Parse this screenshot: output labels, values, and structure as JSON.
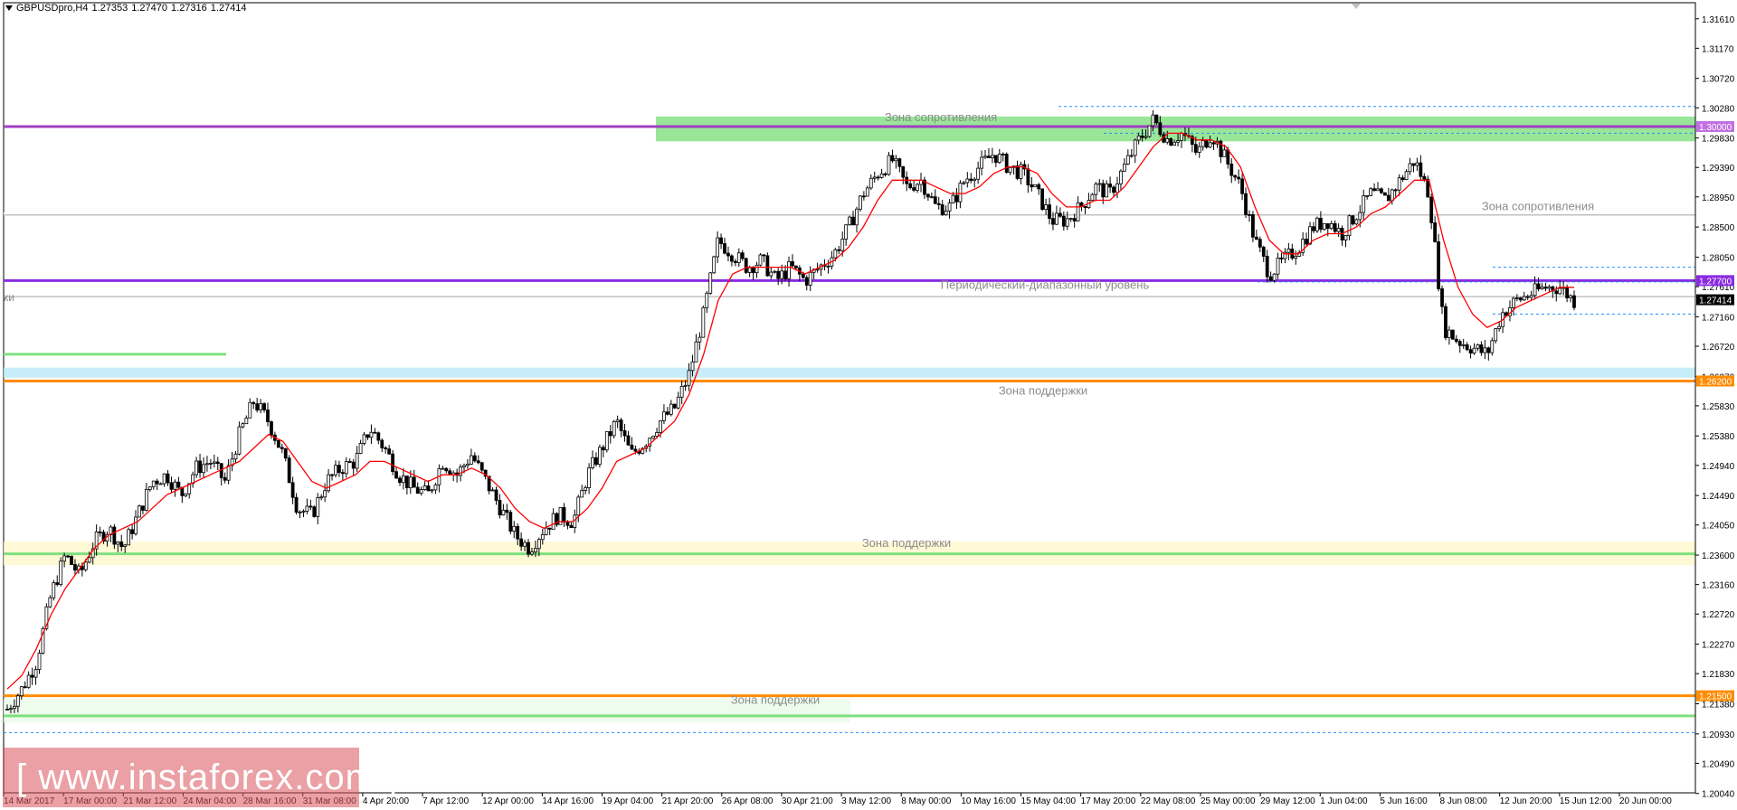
{
  "header": {
    "symbol": "GBPUSDpro,H4",
    "open": "1.27353",
    "high": "1.27470",
    "low": "1.27316",
    "close": "1.27414"
  },
  "watermark": "[ www.instaforex.com ]",
  "left_cut_label": "ки",
  "colors": {
    "candle": "#000000",
    "ma": "#ff0000",
    "zone_green": "#7fe07f",
    "level_purple": "#a040c0",
    "level_violet": "#8a2be2",
    "level_orange": "#ff8c00",
    "level_gray": "#c0c0c0",
    "dashed": "#1e90ff",
    "grid_axis": "#000000"
  },
  "chart_data": {
    "type": "line",
    "title": "GBPUSDpro,H4",
    "instrument": "GBPUSDpro",
    "timeframe": "H4",
    "ylim": [
      1.2005,
      1.3185
    ],
    "y_ticks": [
      "1.31610",
      "1.31170",
      "1.30720",
      "1.30280",
      "1.29830",
      "1.29390",
      "1.28950",
      "1.28500",
      "1.28050",
      "1.27610",
      "1.27160",
      "1.26720",
      "1.26270",
      "1.25830",
      "1.25380",
      "1.24940",
      "1.24490",
      "1.24050",
      "1.23600",
      "1.23160",
      "1.22720",
      "1.22270",
      "1.21830",
      "1.21380",
      "1.20930",
      "1.20490",
      "1.20040"
    ],
    "x_ticks": [
      "14 Mar 2017",
      "17 Mar 00:00",
      "21 Mar 12:00",
      "24 Mar 04:00",
      "28 Mar 16:00",
      "31 Mar 08:00",
      "4 Apr 20:00",
      "7 Apr 12:00",
      "12 Apr 00:00",
      "14 Apr 16:00",
      "19 Apr 04:00",
      "21 Apr 20:00",
      "26 Apr 08:00",
      "30 Apr 21:00",
      "3 May 12:00",
      "8 May 00:00",
      "10 May 16:00",
      "15 May 04:00",
      "17 May 20:00",
      "22 May 08:00",
      "25 May 00:00",
      "29 May 12:00",
      "1 Jun 04:00",
      "5 Jun 16:00",
      "8 Jun 08:00",
      "12 Jun 20:00",
      "15 Jun 12:00",
      "20 Jun 00:00"
    ],
    "price_close_path": [
      1.213,
      1.216,
      1.22,
      1.23,
      1.236,
      1.233,
      1.238,
      1.24,
      1.237,
      1.242,
      1.247,
      1.248,
      1.245,
      1.249,
      1.25,
      1.247,
      1.254,
      1.259,
      1.256,
      1.251,
      1.243,
      1.242,
      1.247,
      1.249,
      1.25,
      1.255,
      1.252,
      1.248,
      1.246,
      1.245,
      1.25,
      1.248,
      1.251,
      1.247,
      1.243,
      1.239,
      1.237,
      1.24,
      1.242,
      1.241,
      1.248,
      1.252,
      1.256,
      1.251,
      1.253,
      1.256,
      1.258,
      1.263,
      1.272,
      1.283,
      1.281,
      1.279,
      1.28,
      1.277,
      1.279,
      1.277,
      1.279,
      1.281,
      1.285,
      1.29,
      1.293,
      1.295,
      1.291,
      1.292,
      1.288,
      1.288,
      1.292,
      1.294,
      1.296,
      1.294,
      1.293,
      1.29,
      1.286,
      1.286,
      1.288,
      1.291,
      1.29,
      1.294,
      1.298,
      1.301,
      1.298,
      1.299,
      1.296,
      1.299,
      1.295,
      1.291,
      1.283,
      1.278,
      1.28,
      1.282,
      1.285,
      1.286,
      1.284,
      1.287,
      1.29,
      1.289,
      1.292,
      1.295,
      1.29,
      1.27,
      1.268,
      1.267,
      1.266,
      1.272,
      1.274,
      1.275,
      1.276,
      1.276,
      1.274
    ],
    "ma_path": [
      1.216,
      1.218,
      1.222,
      1.227,
      1.231,
      1.234,
      1.237,
      1.239,
      1.24,
      1.241,
      1.243,
      1.245,
      1.246,
      1.247,
      1.248,
      1.249,
      1.25,
      1.252,
      1.254,
      1.253,
      1.25,
      1.247,
      1.246,
      1.247,
      1.248,
      1.25,
      1.25,
      1.249,
      1.248,
      1.247,
      1.248,
      1.248,
      1.249,
      1.248,
      1.246,
      1.243,
      1.241,
      1.24,
      1.241,
      1.241,
      1.243,
      1.246,
      1.25,
      1.251,
      1.252,
      1.254,
      1.256,
      1.26,
      1.266,
      1.274,
      1.278,
      1.279,
      1.279,
      1.279,
      1.279,
      1.278,
      1.279,
      1.28,
      1.282,
      1.285,
      1.289,
      1.292,
      1.292,
      1.292,
      1.291,
      1.29,
      1.29,
      1.291,
      1.293,
      1.294,
      1.294,
      1.293,
      1.29,
      1.288,
      1.288,
      1.289,
      1.289,
      1.291,
      1.294,
      1.297,
      1.299,
      1.299,
      1.298,
      1.298,
      1.297,
      1.294,
      1.288,
      1.283,
      1.281,
      1.281,
      1.283,
      1.284,
      1.284,
      1.285,
      1.287,
      1.288,
      1.29,
      1.292,
      1.292,
      1.283,
      1.276,
      1.272,
      1.27,
      1.271,
      1.273,
      1.274,
      1.275,
      1.276,
      1.276
    ],
    "levels": [
      {
        "price": 1.3,
        "label": "1.30000",
        "color": "#a040c0"
      },
      {
        "price": 1.277,
        "label": "1.27700",
        "color": "#8a2be2"
      },
      {
        "price": 1.262,
        "label": "1.26200",
        "color": "#ff8c00"
      },
      {
        "price": 1.215,
        "label": "1.21500",
        "color": "#ff8c00"
      },
      {
        "price": 1.2868,
        "label": "",
        "color": "#c0c0c0"
      },
      {
        "price": 1.2746,
        "label": "",
        "color": "#c0c0c0"
      }
    ],
    "current_price_label": "1.27414",
    "zones": [
      {
        "label": "Зона сопротивления",
        "top": 1.3015,
        "bottom": 1.2978
      },
      {
        "label": "Зона сопротивления",
        "top": 1.2872,
        "bottom": 1.2868
      },
      {
        "label": "Периодический-диапазонный уровень",
        "top": 1.2772,
        "bottom": 1.2768
      },
      {
        "label": "Зона поддержки",
        "top": 1.264,
        "bottom": 1.2625
      },
      {
        "label": "Зона поддержки",
        "top": 1.238,
        "bottom": 1.2345
      },
      {
        "label": "Зона поддержки",
        "top": 1.2145,
        "bottom": 1.211
      }
    ]
  }
}
